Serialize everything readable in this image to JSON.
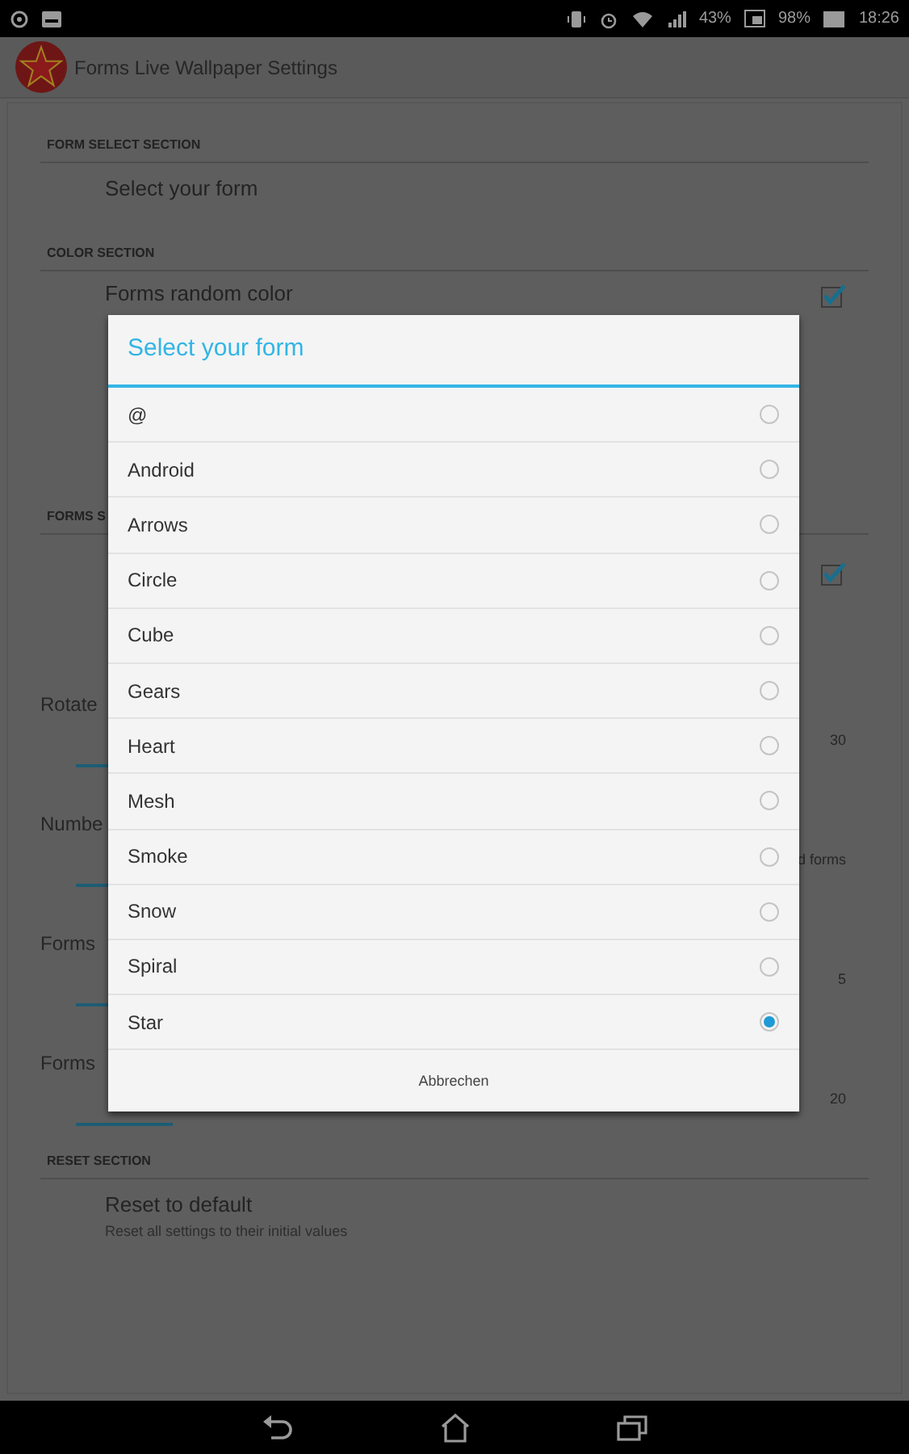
{
  "status_bar": {
    "signal_percent": "43%",
    "battery_percent": "98%",
    "time": "18:26"
  },
  "app_bar": {
    "title": "Forms Live Wallpaper Settings"
  },
  "sections": [
    {
      "header": "FORM SELECT SECTION",
      "items": [
        {
          "kind": "text",
          "title": "Select your form"
        }
      ]
    },
    {
      "header": "COLOR SECTION",
      "items": [
        {
          "kind": "checkbox",
          "title": "Forms random color",
          "checked": true
        }
      ]
    },
    {
      "header": "FORMS S",
      "items": [
        {
          "kind": "checkbox",
          "checked": true
        },
        {
          "kind": "slider",
          "title": "Rotate",
          "value": "30"
        },
        {
          "kind": "slider",
          "title": "Numbe",
          "value": "d forms"
        },
        {
          "kind": "slider",
          "title": "Forms",
          "value": "5"
        },
        {
          "kind": "slider",
          "title": "Forms",
          "value": "20"
        }
      ]
    },
    {
      "header": "RESET SECTION",
      "items": [
        {
          "kind": "text",
          "title": "Reset to default",
          "summary": "Reset all settings to their initial values"
        }
      ]
    }
  ],
  "dialog": {
    "title": "Select your form",
    "options": [
      {
        "label": "@",
        "selected": false
      },
      {
        "label": "Android",
        "selected": false
      },
      {
        "label": "Arrows",
        "selected": false
      },
      {
        "label": "Circle",
        "selected": false
      },
      {
        "label": "Cube",
        "selected": false
      },
      {
        "label": "Gears",
        "selected": false
      },
      {
        "label": "Heart",
        "selected": false
      },
      {
        "label": "Mesh",
        "selected": false
      },
      {
        "label": "Smoke",
        "selected": false
      },
      {
        "label": "Snow",
        "selected": false
      },
      {
        "label": "Spiral",
        "selected": false
      },
      {
        "label": "Star",
        "selected": true
      }
    ],
    "cancel": "Abbrechen"
  }
}
